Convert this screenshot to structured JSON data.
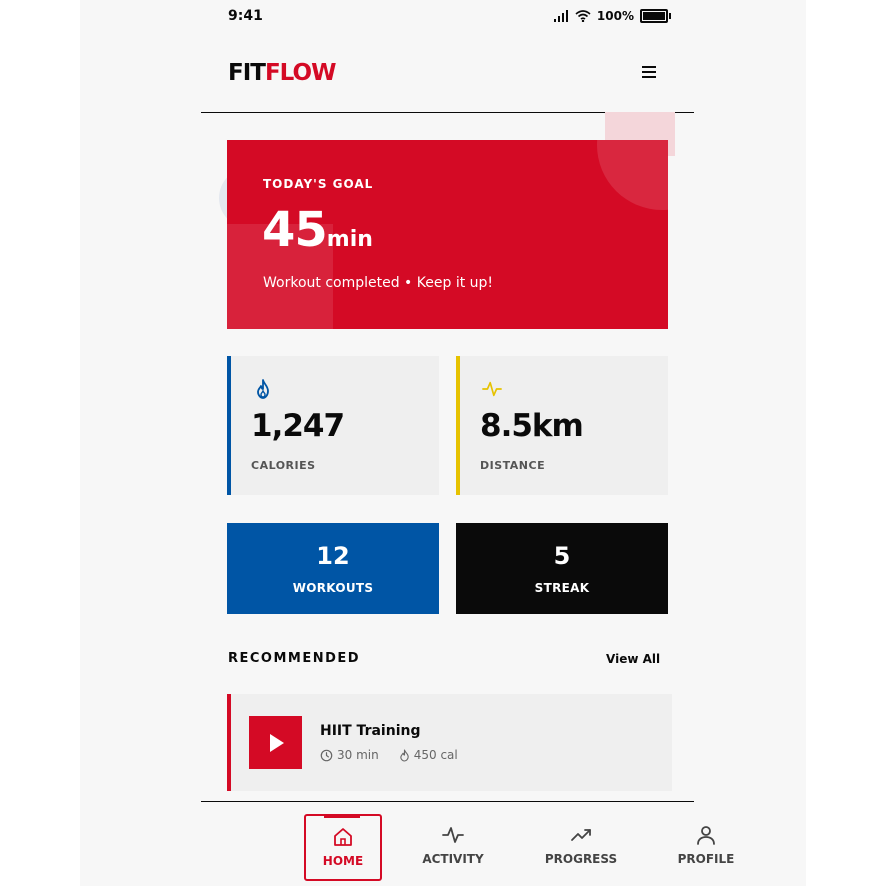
{
  "status": {
    "time": "9:41",
    "battery": "100%"
  },
  "header": {
    "logo_fit": "FIT",
    "logo_flow": "FLOW"
  },
  "goal": {
    "label": "TODAY'S GOAL",
    "value": "45",
    "unit": "min",
    "subtitle": "Workout completed • Keep it up!"
  },
  "stats": {
    "calories": {
      "value": "1,247",
      "label": "CALORIES"
    },
    "distance": {
      "value": "8.5km",
      "label": "DISTANCE"
    }
  },
  "tiles": {
    "workouts": {
      "value": "12",
      "label": "WORKOUTS"
    },
    "streak": {
      "value": "5",
      "label": "STREAK"
    }
  },
  "recommended": {
    "title": "RECOMMENDED",
    "view_all": "View All",
    "items": [
      {
        "title": "HIIT Training",
        "duration": "30 min",
        "calories": "450 cal"
      }
    ]
  },
  "nav": {
    "items": [
      {
        "label": "HOME",
        "icon": "home-icon",
        "active": true
      },
      {
        "label": "ACTIVITY",
        "icon": "activity-icon"
      },
      {
        "label": "PROGRESS",
        "icon": "trending-up-icon"
      },
      {
        "label": "PROFILE",
        "icon": "user-icon"
      }
    ]
  },
  "colors": {
    "brand_red": "#d40a25",
    "blue": "#0055a5",
    "yellow": "#e6c200",
    "black": "#0a0a0a"
  }
}
